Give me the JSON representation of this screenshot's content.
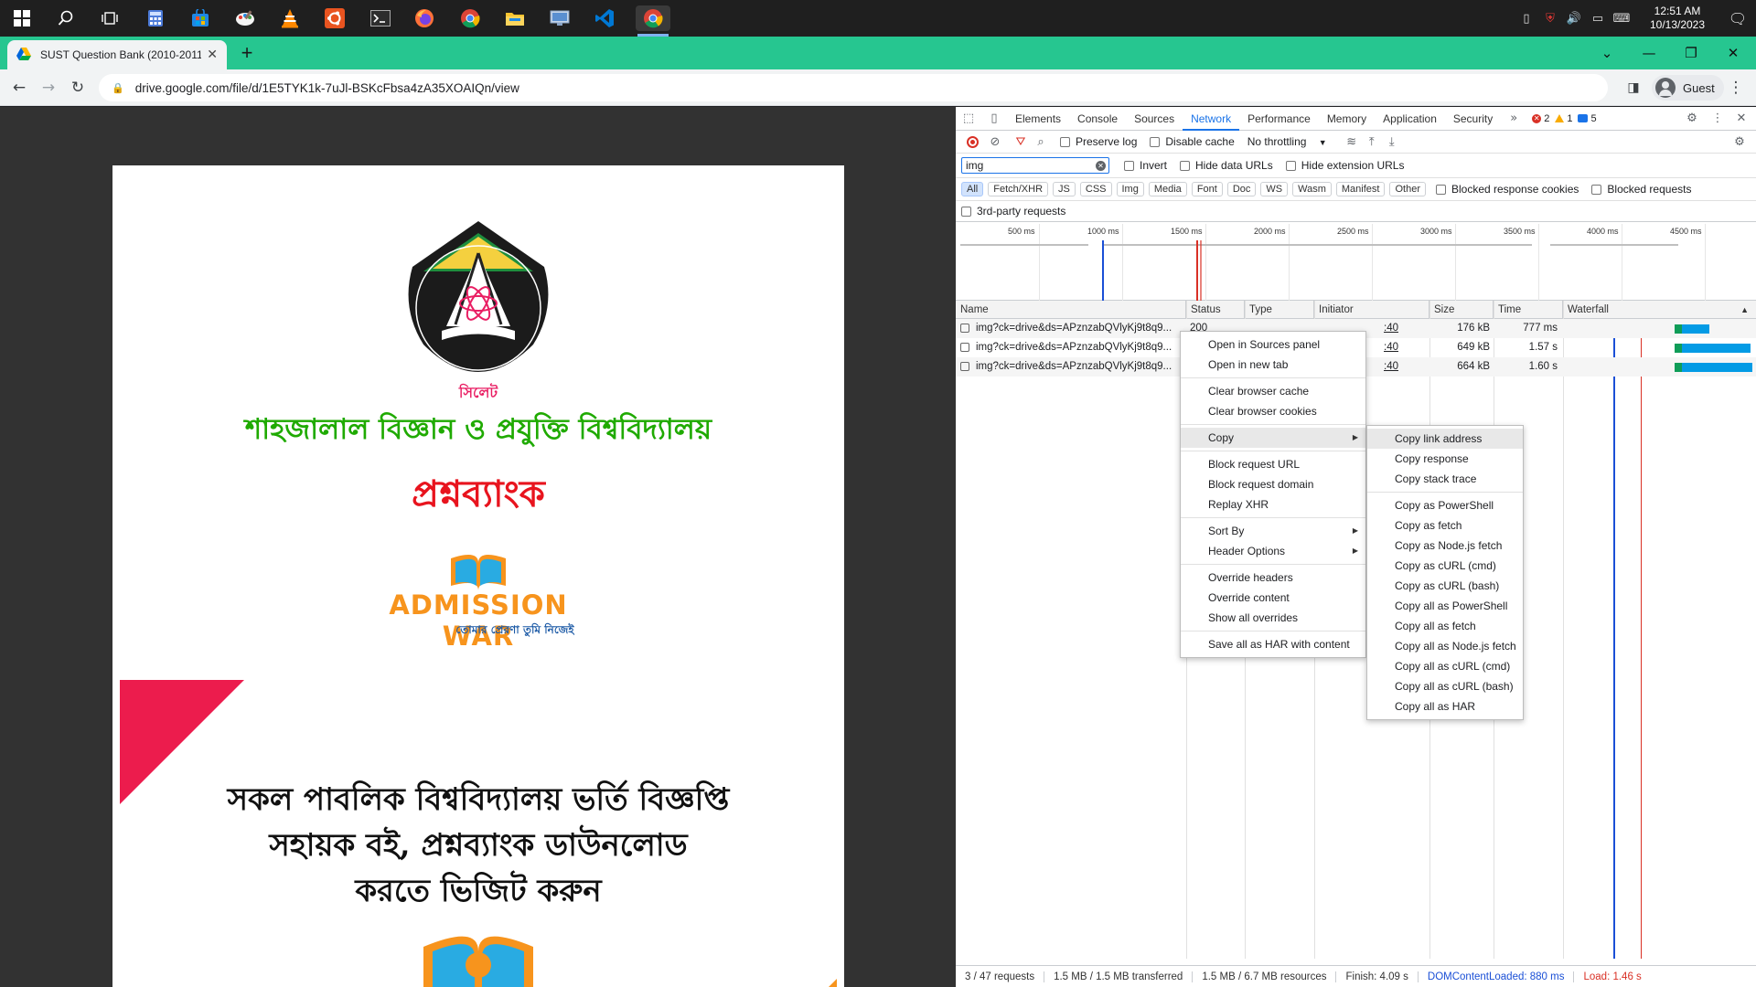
{
  "taskbar": {
    "icons": [
      "windows-start-icon",
      "search-icon",
      "task-view-icon",
      "calculator-icon",
      "store-icon",
      "paint-icon",
      "vlc-icon",
      "ubuntu-icon",
      "terminal-icon",
      "firefox-icon",
      "chrome-icon",
      "file-explorer-icon",
      "remote-desktop-icon",
      "vscode-icon",
      "chrome-active-icon"
    ],
    "clock_time": "12:51 AM",
    "clock_date": "10/13/2023"
  },
  "browser": {
    "tab_title": "SUST Question Bank (2010-2011",
    "url": "drive.google.com/file/d/1E5TYK1k-7uJl-BSKcFbsa4zA35XOAIQn/view",
    "profile": "Guest",
    "accent_color": "#26c690"
  },
  "document": {
    "university_name": "শাহজালাল বিজ্ঞান ও প্রযুক্তি বিশ্ববিদ্যালয়",
    "question_bank": "প্রশ্নব্যাংক",
    "brand": "ADMISSION WAR",
    "brand_tagline": "তোমার প্রেরণা তুমি নিজেই",
    "promo_line1": "সকল পাবলিক বিশ্ববিদ্যালয় ভর্তি বিজ্ঞপ্তি",
    "promo_line2": "সহায়ক বই, প্রশ্নব্যাংক ডাউনলোড",
    "promo_line3": "করতে ভিজিট করুন",
    "logo_city": "সিলেট"
  },
  "devtools": {
    "tabs": [
      "Elements",
      "Console",
      "Sources",
      "Network",
      "Performance",
      "Memory",
      "Application",
      "Security"
    ],
    "active_tab": "Network",
    "errors": "2",
    "warnings": "1",
    "messages": "5",
    "preserve_log": "Preserve log",
    "disable_cache": "Disable cache",
    "throttling": "No throttling",
    "filter_value": "img",
    "invert": "Invert",
    "hide_data_urls": "Hide data URLs",
    "hide_extension_urls": "Hide extension URLs",
    "type_filters": [
      "All",
      "Fetch/XHR",
      "JS",
      "CSS",
      "Img",
      "Media",
      "Font",
      "Doc",
      "WS",
      "Wasm",
      "Manifest",
      "Other"
    ],
    "blocked_response_cookies": "Blocked response cookies",
    "blocked_requests": "Blocked requests",
    "third_party": "3rd-party requests",
    "overview_ticks": [
      "500 ms",
      "1000 ms",
      "1500 ms",
      "2000 ms",
      "2500 ms",
      "3000 ms",
      "3500 ms",
      "4000 ms",
      "4500 ms"
    ],
    "columns": [
      "Name",
      "Status",
      "Type",
      "Initiator",
      "Size",
      "Time",
      "Waterfall"
    ],
    "requests": [
      {
        "name": "img?ck=drive&ds=APznzabQVlyKj9t8q9...",
        "status": "200",
        "initiator": ":40",
        "size": "176 kB",
        "time": "777 ms"
      },
      {
        "name": "img?ck=drive&ds=APznzabQVlyKj9t8q9...",
        "status": "",
        "initiator": ":40",
        "size": "649 kB",
        "time": "1.57 s"
      },
      {
        "name": "img?ck=drive&ds=APznzabQVlyKj9t8q9...",
        "status": "",
        "initiator": ":40",
        "size": "664 kB",
        "time": "1.60 s"
      }
    ],
    "summary": {
      "requests": "3 / 47 requests",
      "transferred": "1.5 MB / 1.5 MB transferred",
      "resources": "1.5 MB / 6.7 MB resources",
      "finish": "Finish: 4.09 s",
      "dcl": "DOMContentLoaded: 880 ms",
      "load": "Load: 1.46 s"
    }
  },
  "context_menu": {
    "items": [
      "Open in Sources panel",
      "Open in new tab",
      "Clear browser cache",
      "Clear browser cookies",
      "Copy",
      "Block request URL",
      "Block request domain",
      "Replay XHR",
      "Sort By",
      "Header Options",
      "Override headers",
      "Override content",
      "Show all overrides",
      "Save all as HAR with content"
    ]
  },
  "copy_submenu": {
    "items": [
      "Copy link address",
      "Copy response",
      "Copy stack trace",
      "Copy as PowerShell",
      "Copy as fetch",
      "Copy as Node.js fetch",
      "Copy as cURL (cmd)",
      "Copy as cURL (bash)",
      "Copy all as PowerShell",
      "Copy all as fetch",
      "Copy all as Node.js fetch",
      "Copy all as cURL (cmd)",
      "Copy all as cURL (bash)",
      "Copy all as HAR"
    ]
  }
}
